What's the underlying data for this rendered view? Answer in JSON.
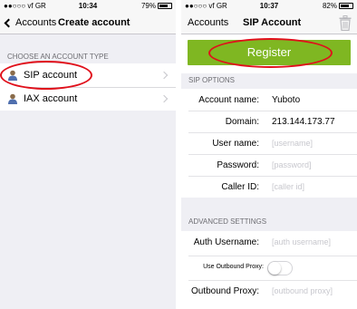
{
  "left": {
    "status": {
      "carrier": "●●○○○ vf GR",
      "time": "10:34",
      "battery": "79%",
      "battery_level": 0.79
    },
    "nav": {
      "back_label": "Accounts",
      "title": "Create account"
    },
    "section_header": "CHOOSE AN ACCOUNT TYPE",
    "items": [
      {
        "label": "SIP account"
      },
      {
        "label": "IAX account"
      }
    ]
  },
  "right": {
    "status": {
      "carrier": "●●○○○ vf GR",
      "time": "10:37",
      "battery": "82%",
      "battery_level": 0.82
    },
    "nav": {
      "back_label": "Accounts",
      "title": "SIP Account"
    },
    "register_label": "Register",
    "sip_options_header": "SIP OPTIONS",
    "sip_fields": [
      {
        "label": "Account name:",
        "value": "Yuboto"
      },
      {
        "label": "Domain:",
        "value": "213.144.173.77"
      },
      {
        "label": "User name:",
        "placeholder": "[username]"
      },
      {
        "label": "Password:",
        "placeholder": "[password]"
      },
      {
        "label": "Caller ID:",
        "placeholder": "[caller id]"
      }
    ],
    "advanced_header": "ADVANCED SETTINGS",
    "advanced_fields": {
      "auth_username": {
        "label": "Auth Username:",
        "placeholder": "[auth username]"
      },
      "use_outbound_proxy": {
        "label": "Use Outbound Proxy:",
        "on": false
      },
      "outbound_proxy": {
        "label": "Outbound Proxy:",
        "placeholder": "[outbound proxy]"
      }
    }
  },
  "colors": {
    "accent_green": "#7fb722",
    "highlight_red": "#e0101b",
    "group_bg": "#efeff4"
  }
}
